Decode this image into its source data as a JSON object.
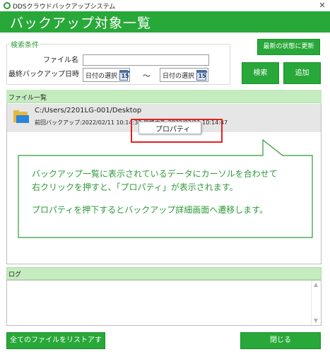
{
  "window": {
    "title": "DDSクラウドバックアップシステム",
    "close_glyph": "✕"
  },
  "header": {
    "title": "バックアップ対象一覧"
  },
  "search": {
    "legend": "検索条件",
    "filename_label": "ファイル名",
    "filename_value": "",
    "last_backup_label": "最終バックアップ日時",
    "date_from_label": "日付の選択",
    "date_to_label": "日付の選択",
    "calendar_day": "15",
    "range_separator": "～"
  },
  "buttons": {
    "refresh": "最新の状態に更新",
    "search": "検索",
    "add": "追加",
    "list_all": "全てのファイルをリストアする",
    "close": "閉じる"
  },
  "file_list": {
    "title": "ファイル一覧",
    "items": [
      {
        "path": "C:/Users/2201LG-001/Desktop",
        "last_backup": "前回バックアップ:2022/02/11 10:14:38  最終更新:2022/02/11 10:14:47"
      }
    ]
  },
  "context_menu": {
    "items": [
      "プロパティ"
    ]
  },
  "callout": {
    "line1": "バックアップ一覧に表示されているデータにカーソルを合わせて",
    "line2": "右クリックを押すと、「プロパティ」が表示されます。",
    "line3": "プロパティを押下するとバックアップ詳細画面へ遷移します。"
  },
  "log": {
    "title": "ログ",
    "content": ""
  },
  "colors": {
    "accent_green": "#28a838",
    "panel_header_green": "#c5ecbf",
    "highlight_red": "#e82020",
    "callout_green": "#2e9a3a"
  },
  "icons": {
    "app": "app-logo-icon",
    "calendar": "calendar-icon",
    "folder": "folder-icon",
    "scroll_up": "chevron-up-icon",
    "scroll_down": "chevron-down-icon"
  }
}
